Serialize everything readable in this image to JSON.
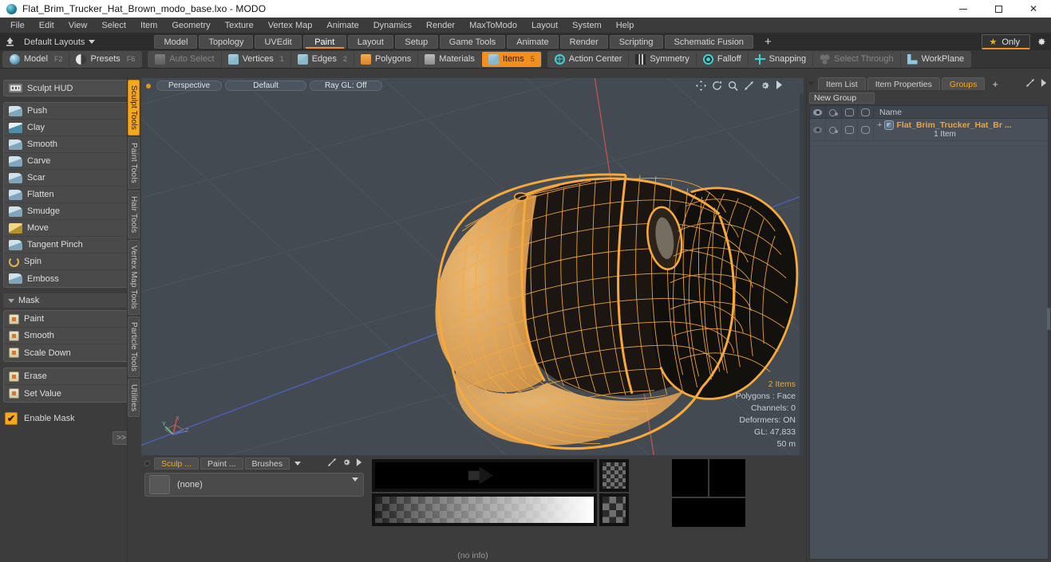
{
  "window": {
    "title": "Flat_Brim_Trucker_Hat_Brown_modo_base.lxo - MODO",
    "app_icon": "modo-sphere-icon",
    "minimize": "minimize-icon",
    "maximize": "maximize-icon",
    "close": "✕"
  },
  "menubar": {
    "items": [
      "File",
      "Edit",
      "View",
      "Select",
      "Item",
      "Geometry",
      "Texture",
      "Vertex Map",
      "Animate",
      "Dynamics",
      "Render",
      "MaxToModo",
      "Layout",
      "System",
      "Help"
    ]
  },
  "layoutbar": {
    "up_icon": "upload-icon",
    "layouts_label": "Default Layouts",
    "tabs": [
      {
        "label": "Model",
        "active": false
      },
      {
        "label": "Topology",
        "active": false
      },
      {
        "label": "UVEdit",
        "active": false
      },
      {
        "label": "Paint",
        "active": true
      },
      {
        "label": "Layout",
        "active": false
      },
      {
        "label": "Setup",
        "active": false
      },
      {
        "label": "Game Tools",
        "active": false
      },
      {
        "label": "Animate",
        "active": false
      },
      {
        "label": "Render",
        "active": false
      },
      {
        "label": "Scripting",
        "active": false
      },
      {
        "label": "Schematic Fusion",
        "active": false
      }
    ],
    "add_label": "+",
    "only_label": "Only",
    "star_icon": "star-icon",
    "gear_icon": "gear-icon",
    "accent": "#f3901d"
  },
  "modebar": {
    "group1": [
      {
        "label": "Model",
        "key": "F2",
        "icon": "sphere-icon",
        "active": false,
        "dim": false
      },
      {
        "label": "Presets",
        "key": "F6",
        "icon": "half-sphere-icon",
        "active": false,
        "dim": false
      }
    ],
    "group2": [
      {
        "label": "Auto Select",
        "key": "",
        "icon": "cube-dim-icon",
        "active": false,
        "dim": true
      },
      {
        "label": "Vertices",
        "key": "1",
        "icon": "cube-icon",
        "active": false,
        "dim": false
      },
      {
        "label": "Edges",
        "key": "2",
        "icon": "cube-icon",
        "active": false,
        "dim": false
      },
      {
        "label": "Polygons",
        "key": "",
        "icon": "cube-orange-icon",
        "active": false,
        "dim": false
      },
      {
        "label": "Materials",
        "key": "",
        "icon": "cube-gray-icon",
        "active": false,
        "dim": false
      },
      {
        "label": "Items",
        "key": "5",
        "icon": "cube-icon",
        "active": true,
        "dim": false
      }
    ],
    "group3": [
      {
        "label": "Action Center",
        "icon": "target-icon",
        "dim": false
      },
      {
        "label": "Symmetry",
        "icon": "symmetry-icon",
        "dim": false
      },
      {
        "label": "Falloff",
        "icon": "falloff-icon",
        "dim": false
      },
      {
        "label": "Snapping",
        "icon": "snap-icon",
        "dim": false
      },
      {
        "label": "Select Through",
        "icon": "select-through-icon",
        "dim": true
      },
      {
        "label": "WorkPlane",
        "icon": "workplane-icon",
        "dim": false
      }
    ]
  },
  "left_panel": {
    "hud_button": {
      "label": "Sculpt HUD",
      "icon": "hud-icon"
    },
    "sculpt_tools": [
      {
        "label": "Push",
        "icon": "brush-icon",
        "corner": true
      },
      {
        "label": "Clay",
        "icon": "clay-icon",
        "corner": false
      },
      {
        "label": "Smooth",
        "icon": "brush-icon",
        "corner": false
      },
      {
        "label": "Carve",
        "icon": "brush-icon",
        "corner": false
      },
      {
        "label": "Scar",
        "icon": "brush-icon",
        "corner": false
      },
      {
        "label": "Flatten",
        "icon": "brush-icon",
        "corner": false
      },
      {
        "label": "Smudge",
        "icon": "brush-icon",
        "corner": false
      },
      {
        "label": "Move",
        "icon": "move-icon",
        "corner": false
      },
      {
        "label": "Tangent Pinch",
        "icon": "brush-icon",
        "corner": true
      },
      {
        "label": "Spin",
        "icon": "spin-icon",
        "corner": false
      },
      {
        "label": "Emboss",
        "icon": "brush-icon",
        "corner": true
      }
    ],
    "mask_header": {
      "label": "Mask",
      "icon": "triangle-down-icon"
    },
    "mask_tools": [
      {
        "label": "Paint",
        "icon": "mask-icon"
      },
      {
        "label": "Smooth",
        "icon": "mask-icon"
      },
      {
        "label": "Scale Down",
        "icon": "mask-icon"
      }
    ],
    "mask_tools2": [
      {
        "label": "Erase",
        "icon": "mask-icon"
      },
      {
        "label": "Set Value",
        "icon": "mask-icon"
      }
    ],
    "enable_mask": {
      "label": "Enable Mask",
      "checked": true,
      "check_glyph": "✔"
    },
    "more_label": ">>",
    "vertical_tabs": [
      {
        "label": "Sculpt Tools",
        "active": true
      },
      {
        "label": "Paint Tools",
        "active": false
      },
      {
        "label": "Hair Tools",
        "active": false
      },
      {
        "label": "Vertex Map Tools",
        "active": false
      },
      {
        "label": "Particle Tools",
        "active": false
      },
      {
        "label": "Utilities",
        "active": false
      }
    ]
  },
  "viewport": {
    "indicator_icon": "active-dot-icon",
    "chips": [
      "Perspective",
      "Default",
      "Ray GL: Off"
    ],
    "icons": [
      "pan-icon",
      "rotate-icon",
      "zoom-icon",
      "fit-icon",
      "gear-icon",
      "play-arrow-icon"
    ],
    "info": {
      "items": "2 Items",
      "polygons": "Polygons : Face",
      "channels": "Channels: 0",
      "deformers": "Deformers: ON",
      "gl": "GL: 47,833",
      "scale": "50 m"
    },
    "axis_labels": [
      "Y",
      "X",
      "Z"
    ],
    "background_color": "#434a52",
    "wireframe_color": "#f7a93c",
    "model_name": "flat-brim-trucker-hat-wireframe"
  },
  "bottom_panel": {
    "tabs": [
      {
        "label": "Sculp ...",
        "active": true
      },
      {
        "label": "Paint ...",
        "active": false
      },
      {
        "label": "Brushes",
        "active": false
      }
    ],
    "caret_icon": "chevron-down-icon",
    "expand_icon": "expand-icon",
    "gear_icon": "gear-icon",
    "arrow_icon": "arrow-right-icon",
    "preset": {
      "value": "(none)",
      "thumb": "preset-thumbnail"
    },
    "status": "(no info)"
  },
  "right_panel": {
    "tabs": [
      {
        "label": "Item List",
        "active": false
      },
      {
        "label": "Item Properties",
        "active": false
      },
      {
        "label": "Groups",
        "active": true
      }
    ],
    "add_label": "+",
    "expand_icon": "expand-icon",
    "arrow_icon": "arrow-right-icon",
    "new_group_label": "New Group",
    "tree_headers": {
      "visibility": "eye-icon",
      "render": "render-icon",
      "lock": "lock-icon",
      "wireframe": "wireframe-icon",
      "name": "Name"
    },
    "tree_rows": [
      {
        "expand": "+",
        "icon": "group-item-icon",
        "label": "Flat_Brim_Trucker_Hat_Br ...",
        "sublabel": "1 Item"
      }
    ]
  }
}
